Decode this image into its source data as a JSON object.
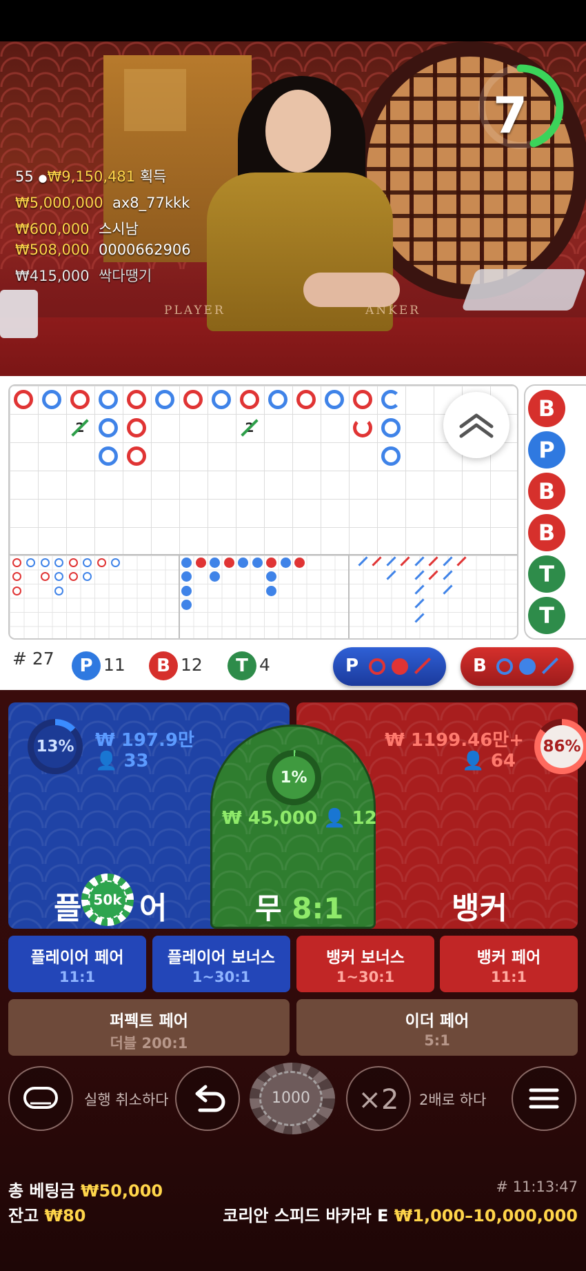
{
  "video": {
    "timer": "7",
    "felt_player": "PLAYER",
    "felt_banker": "ANKER",
    "winners_header": {
      "count": "55",
      "amount": "₩9,150,481",
      "suffix": "획득"
    },
    "winners": [
      {
        "amount": "₩5,000,000",
        "name": "ax8_77kkk"
      },
      {
        "amount": "₩600,000",
        "name": "스시남"
      },
      {
        "amount": "₩508,000",
        "name": "0000662906"
      },
      {
        "amount": "₩415,000",
        "name": "싹다땡기"
      }
    ]
  },
  "roads": {
    "big_road_badge_1": "2",
    "big_road_badge_2": "2",
    "bead_road": [
      "B",
      "P",
      "B",
      "B",
      "T",
      "T"
    ]
  },
  "stats": {
    "rounds_label": "# 27",
    "player_letter": "P",
    "player_count": "11",
    "banker_letter": "B",
    "banker_count": "12",
    "tie_letter": "T",
    "tie_count": "4",
    "predict_player": "P",
    "predict_banker": "B"
  },
  "bets": {
    "player": {
      "pct": "13%",
      "amount": "₩ 197.9만",
      "players": "33",
      "label_left": "플",
      "label_right": "어",
      "chip": "50k"
    },
    "tie": {
      "pct": "1%",
      "amount": "₩ 45,000",
      "players": "12",
      "label": "무",
      "odds": "8:1"
    },
    "banker": {
      "pct": "86%",
      "amount": "₩ 1199.46만+",
      "players": "64",
      "label": "뱅커"
    },
    "side": [
      {
        "name": "플레이어 페어",
        "odds": "11:1"
      },
      {
        "name": "플레이어 보너스",
        "odds": "1~30:1"
      },
      {
        "name": "뱅커 보너스",
        "odds": "1~30:1"
      },
      {
        "name": "뱅커 페어",
        "odds": "11:1"
      }
    ],
    "perfect_pair": {
      "name": "퍼펙트 페어",
      "odds": "더블 200:1"
    },
    "either_pair": {
      "name": "이더 페어",
      "odds": "5:1"
    }
  },
  "controls": {
    "undo_label": "실행 취소하다",
    "chip_value": "1000",
    "double_symbol": "×2",
    "double_label": "2배로 하다"
  },
  "footer": {
    "total_bet_label": "총 베팅금",
    "total_bet_value": "₩50,000",
    "balance_label": "잔고",
    "balance_value": "₩80",
    "round_time": "# 11:13:47",
    "table_name": "코리안 스피드 바카라 E",
    "limits": "₩1,000–10,000,000"
  },
  "colors": {
    "player": "#2f5fd0",
    "banker": "#d0312c",
    "tie": "#2f8a3a",
    "gold": "#ffd54a"
  }
}
